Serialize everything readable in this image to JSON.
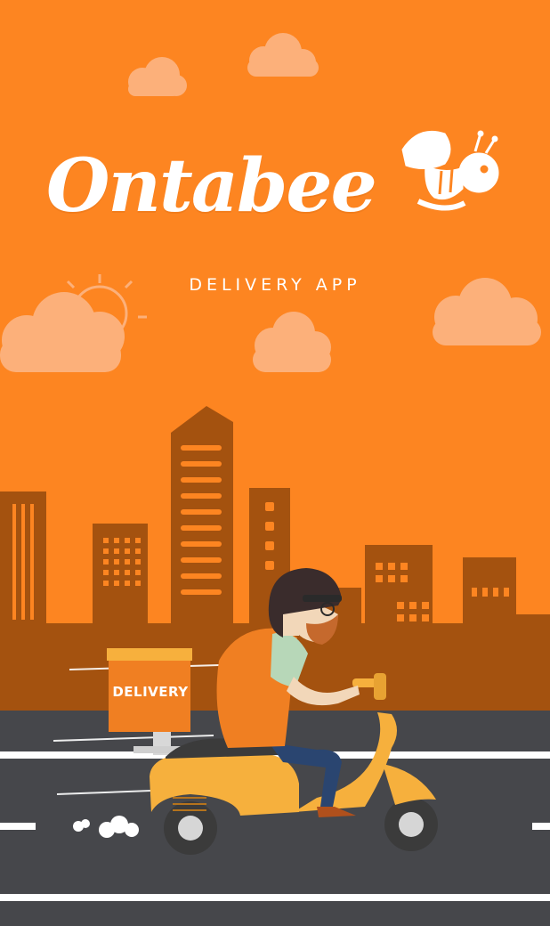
{
  "app": {
    "logo_text": "Ontabee",
    "tagline": "DELIVERY APP",
    "box_label": "DELIVERY"
  },
  "colors": {
    "sky": "#fd8521",
    "skyline": "#a4520f",
    "road": "#46474b",
    "scooter": "#f6b03d",
    "shirt": "#f07f22",
    "cloud": "#fcb07a"
  },
  "icons": [
    "bee-icon",
    "sun-icon",
    "cloud-icon",
    "scooter-icon",
    "rider-icon",
    "delivery-box-icon"
  ]
}
